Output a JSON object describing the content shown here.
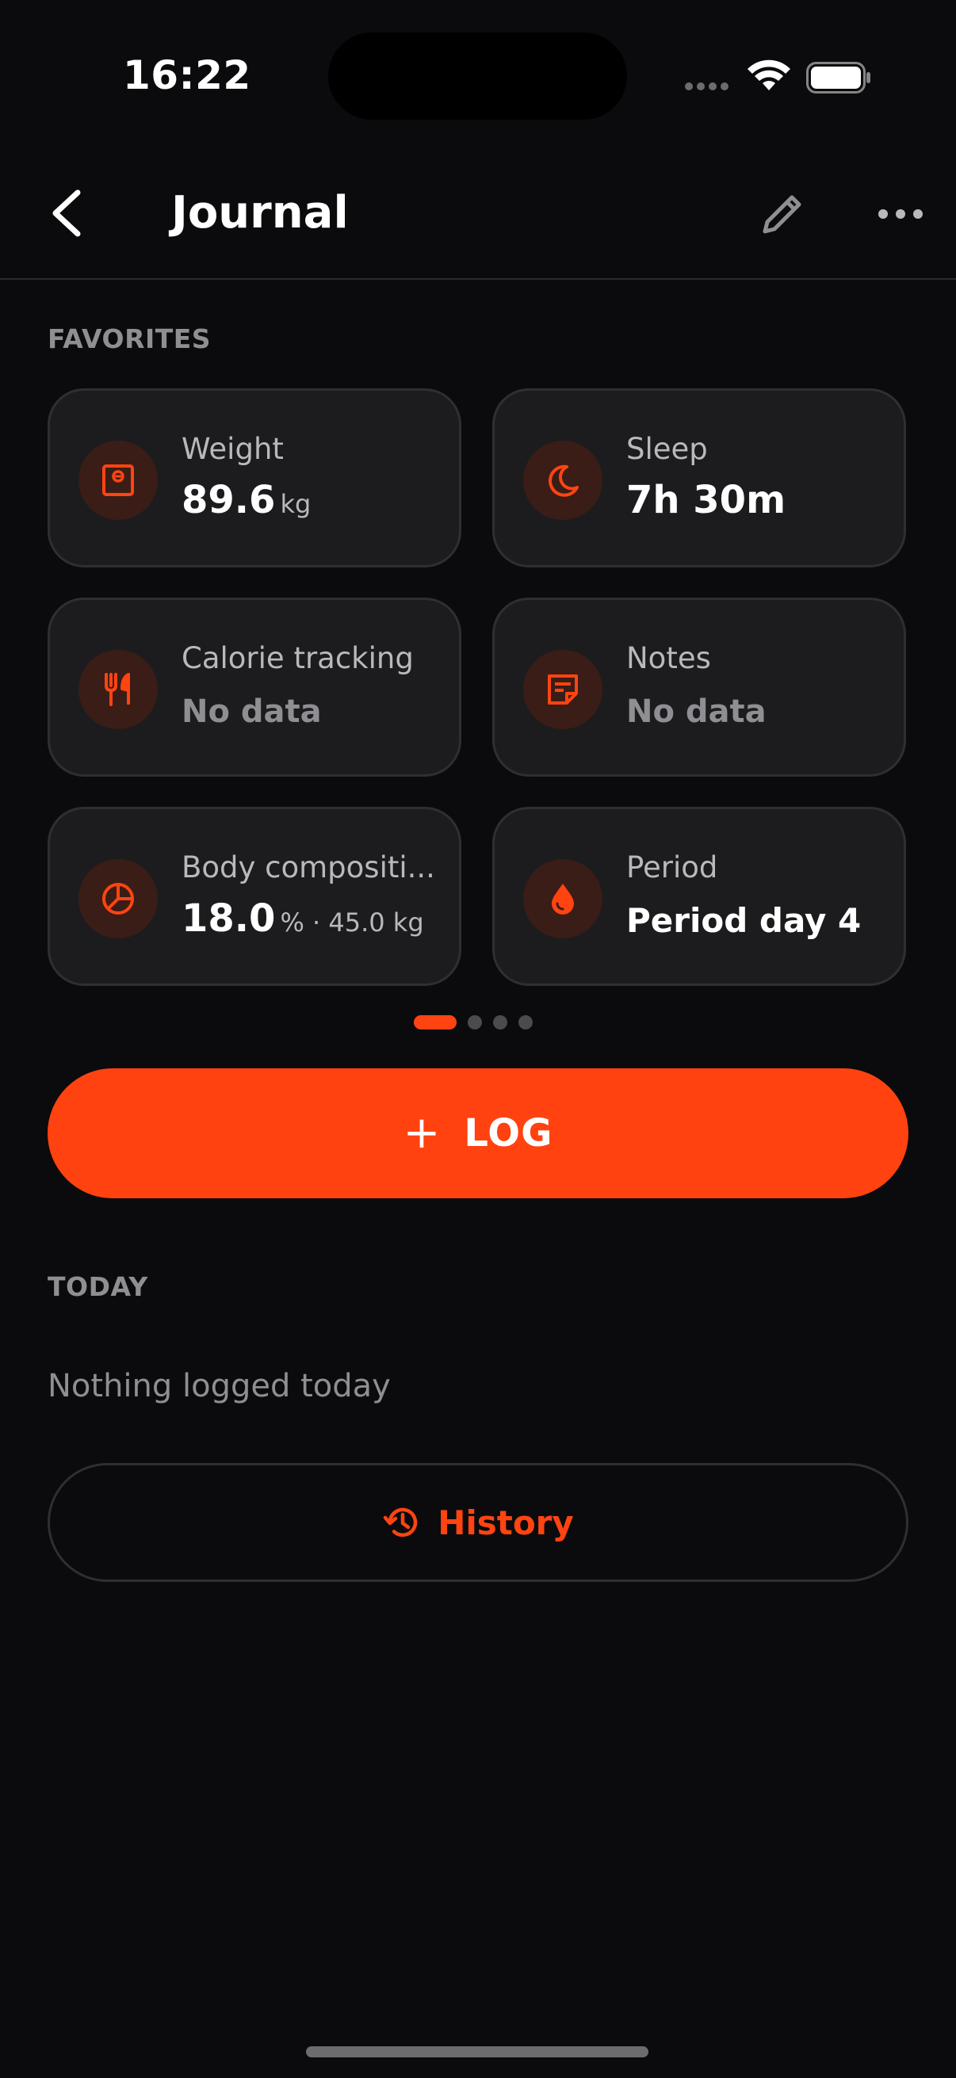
{
  "status_bar": {
    "time": "16:22"
  },
  "nav": {
    "title": "Journal"
  },
  "favorites": {
    "section_label": "FAVORITES",
    "cards": [
      {
        "label": "Weight",
        "value": "89.6",
        "unit": "kg",
        "icon": "scale-icon"
      },
      {
        "label": "Sleep",
        "value": "7h 30m",
        "icon": "moon-icon"
      },
      {
        "label": "Calorie tracking",
        "value": "No data",
        "icon": "fork-knife-icon"
      },
      {
        "label": "Notes",
        "value": "No data",
        "icon": "note-icon"
      },
      {
        "label": "Body compositi...",
        "value": "18.0",
        "unit": "% · 45.0 kg",
        "icon": "pie-chart-icon"
      },
      {
        "label": "Period",
        "value": "Period day 4",
        "icon": "drop-icon"
      }
    ]
  },
  "pager": {
    "pages": 4,
    "current": 1
  },
  "log_button": {
    "label": "LOG"
  },
  "today": {
    "section_label": "TODAY",
    "empty_text": "Nothing logged today"
  },
  "history_button": {
    "label": "History"
  },
  "colors": {
    "accent": "#ff4210",
    "background": "#0b0b0d",
    "card": "#1c1c1f",
    "muted_text": "#8e8e93"
  }
}
